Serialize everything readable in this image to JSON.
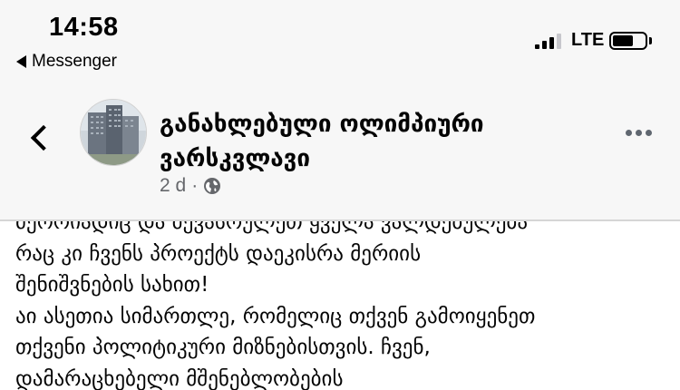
{
  "status_bar": {
    "time": "14:58",
    "back_app": "Messenger",
    "network": "LTE",
    "battery_level": 0.6
  },
  "header": {
    "page_name_line1": "განახლებული ოლიმპიური",
    "page_name_line2": "ვარსკვლავი",
    "age": "2 d",
    "separator": "·",
    "privacy_icon": "globe-icon",
    "more_icon": "more-horizontal-icon",
    "back_icon": "chevron-left-icon"
  },
  "post": {
    "lines": [
      "მეორიადიც და მევასრულეთ ყველა ვალდებულება",
      "რაც კი ჩვენს პროექტს დაეკისრა მერიის",
      "შენიშვნების სახით!",
      "აი ასეთია სიმართლე, რომელიც  თქვენ გამოიყენეთ",
      "თქვენი პოლიტიკური მიზნებისთვის. ჩვენ,",
      "დამარაცხებელი მშენებლობების"
    ]
  }
}
